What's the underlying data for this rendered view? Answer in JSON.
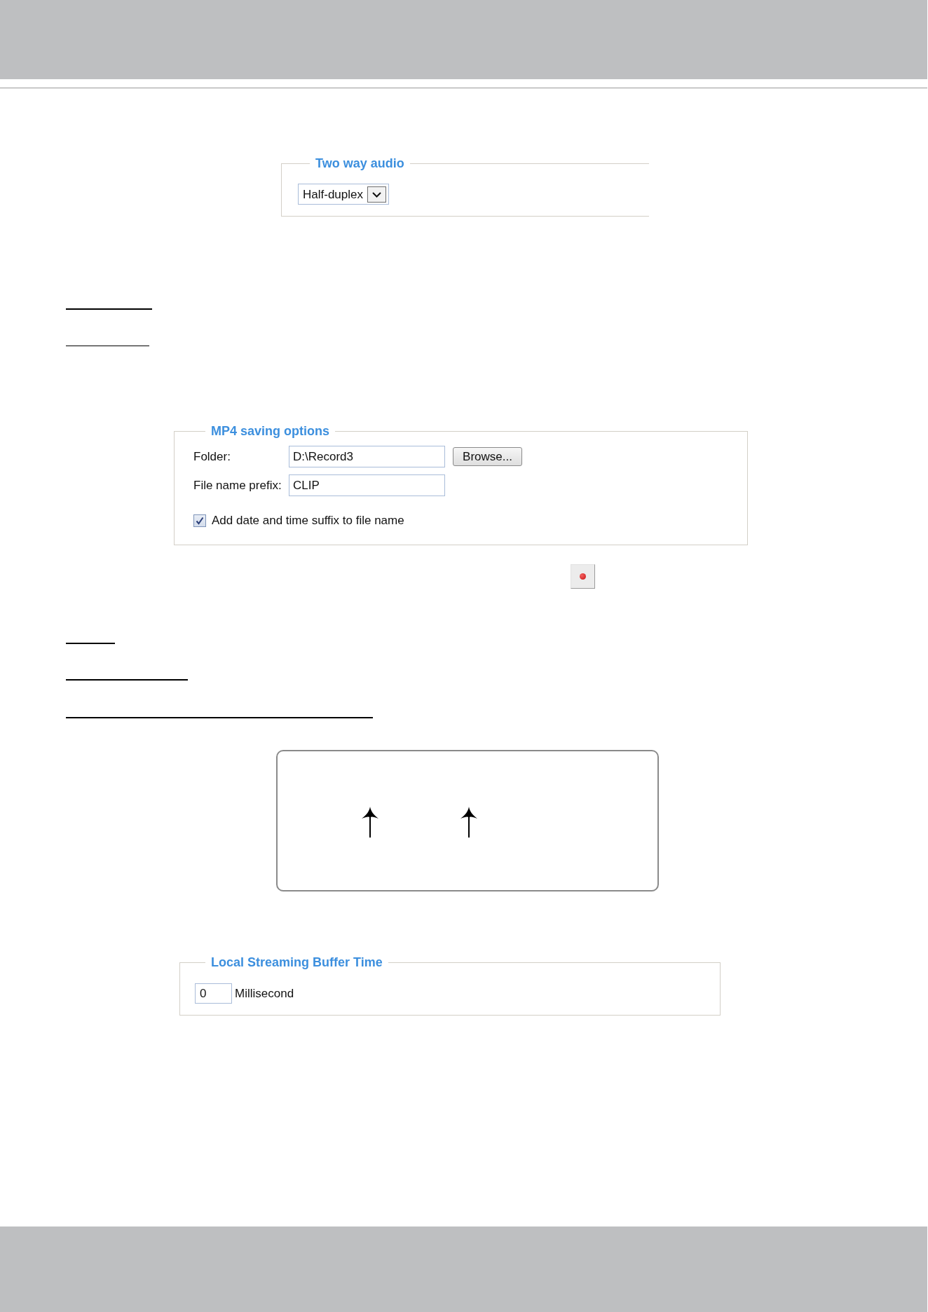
{
  "two_way_audio": {
    "title": "Two way audio",
    "select": {
      "value": "Half-duplex"
    }
  },
  "mp4_saving_options": {
    "title": "MP4 saving options",
    "fields": [
      {
        "label": "Folder:",
        "value": "D:\\Record3",
        "button": "Browse..."
      },
      {
        "label": "File name prefix:",
        "value": "CLIP"
      }
    ],
    "suffix_checkbox": {
      "label": "Add date and time suffix to file name",
      "checked": true
    }
  },
  "local_streaming_buffer_time": {
    "title": "Local Streaming Buffer Time",
    "value": "0",
    "unit": "Millisecond"
  }
}
